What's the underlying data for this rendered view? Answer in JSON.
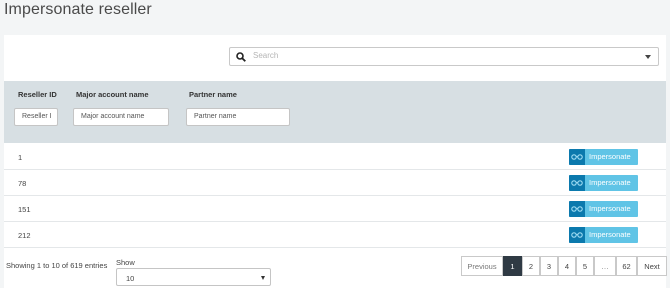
{
  "page": {
    "title": "Impersonate reseller"
  },
  "search": {
    "placeholder": "Search"
  },
  "table": {
    "columns": [
      "Reseller ID",
      "Major account name",
      "Partner name"
    ],
    "filters": [
      "Reseller I",
      "Major account name",
      "Partner name"
    ],
    "rows": [
      {
        "id": "1"
      },
      {
        "id": "78"
      },
      {
        "id": "151"
      },
      {
        "id": "212"
      }
    ],
    "action_label": "Impersonate",
    "action_icon": "glasses-icon"
  },
  "footer": {
    "info": "Showing 1 to 10 of 619 entries",
    "show_label": "Show",
    "show_value": "10"
  },
  "pagination": [
    "Previous",
    "1",
    "2",
    "3",
    "4",
    "5",
    "…",
    "62",
    "Next"
  ],
  "colors": {
    "accent": "#60c4e6",
    "accent_dark": "#0b79ad",
    "active_page": "#2f3a44",
    "header_bg": "#d7dfe3"
  }
}
